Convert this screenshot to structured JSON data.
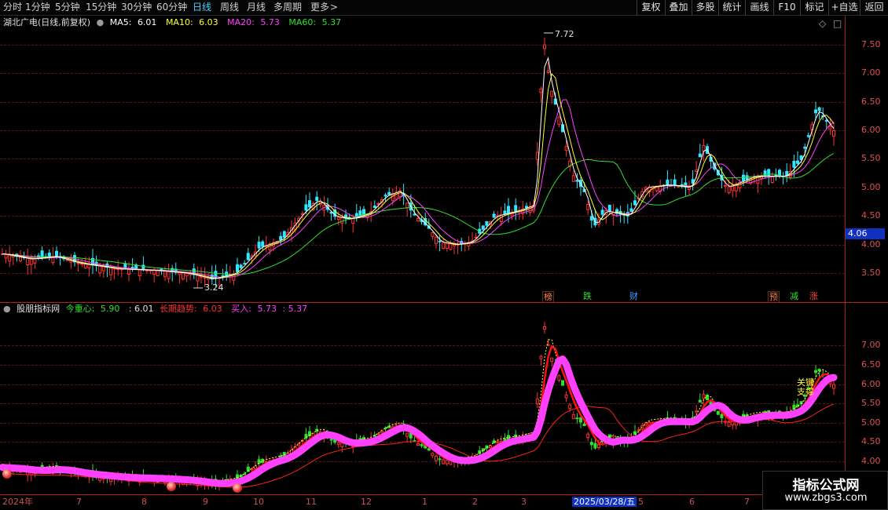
{
  "toolbar": {
    "periods": [
      "分时",
      "1分钟",
      "5分钟",
      "15分钟",
      "30分钟",
      "60分钟",
      "日线",
      "周线",
      "月线",
      "多周期",
      "更多"
    ],
    "active_period": "日线",
    "more_arrow": ">",
    "right_buttons": [
      "复权",
      "叠加",
      "多股",
      "统计",
      "画线",
      "F10",
      "标记",
      "+自选",
      "返回"
    ]
  },
  "main_pane": {
    "stock_title": "湖北广电(日线,前复权)",
    "ma5": {
      "label": "MA5:",
      "value": "6.01",
      "color": "#ffffff"
    },
    "ma10": {
      "label": "MA10:",
      "value": "6.03",
      "color": "#ffff30"
    },
    "ma20": {
      "label": "MA20:",
      "value": "5.73",
      "color": "#ff40ff"
    },
    "ma60": {
      "label": "MA60:",
      "value": "5.37",
      "color": "#30e030"
    },
    "y_ticks": [
      "7.50",
      "7.00",
      "6.50",
      "6.00",
      "5.50",
      "5.00",
      "4.50",
      "4.00",
      "3.50"
    ],
    "current_price": "4.06",
    "high_marker": "7.72",
    "low_marker": "3.24",
    "events": [
      {
        "text": "榜",
        "color": "#ff8040"
      },
      {
        "text": "跌",
        "color": "#30e030"
      },
      {
        "text": "财",
        "color": "#40a0ff"
      },
      {
        "text": "预",
        "color": "#ff8040"
      },
      {
        "text": "减",
        "color": "#30e030"
      },
      {
        "text": "涨",
        "color": "#ff4040"
      }
    ],
    "corner_icons": [
      "◇",
      "□"
    ]
  },
  "sub_pane": {
    "indicator_name": "股朋指标网",
    "center": {
      "label": "今重心:",
      "value": "5.90",
      "extra": ": 6.01",
      "color": "#30e030"
    },
    "long_trend": {
      "label": "长期趋势:",
      "value": "6.03",
      "color": "#ff3030"
    },
    "buy": {
      "label": "买入:",
      "value": "5.73",
      "extra": ": 5.37",
      "color": "#ff40ff"
    },
    "y_ticks": [
      "7.00",
      "6.50",
      "6.00",
      "5.50",
      "5.00",
      "4.50",
      "4.00"
    ],
    "annotation_key": "关键",
    "annotation_support": "支撑"
  },
  "time_axis": {
    "labels": [
      "2024年",
      "7",
      "8",
      "9",
      "10",
      "11",
      "12",
      "1",
      "2",
      "3",
      "2025/03/28/五",
      "5",
      "6",
      "7"
    ]
  },
  "watermark": {
    "title": "指标公式网",
    "url": "www.zbgs3.com"
  },
  "colors": {
    "up": "#ff3030",
    "down": "#30e8ff",
    "grid": "#5a1515",
    "axis": "#e05050"
  }
}
